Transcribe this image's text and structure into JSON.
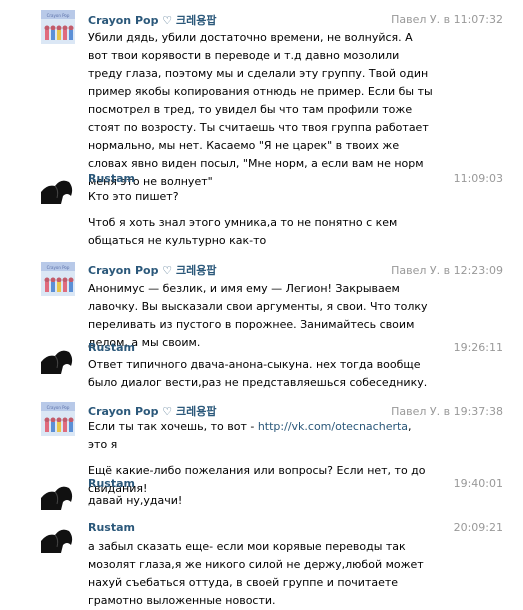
{
  "messages": [
    {
      "author": "Crayon Pop ♡ 크레용팝",
      "reply_to": "Павел У. в",
      "time": "11:07:32",
      "avatar": "group-avatar",
      "paragraphs": [
        "Убили дядь, убили достаточно времени, не волнуйся. А вот твои корявости в переводе и т.д давно мозолили треду глаза, поэтому мы и сделали эту группу. Твой один пример якобы копирования отнюдь не пример. Если бы ты посмотрел в тред, то увидел бы что там профили тоже стоят по возросту. Ты считаешь что твоя группа работает нормально, мы нет. Касаемо \"Я не царек\" в твоих же словах явно виден посыл, \"Мне норм, а если вам не норм меня это не волнует\""
      ]
    },
    {
      "author": "Rustam",
      "reply_to": "",
      "time": "11:09:03",
      "avatar": "user-avatar",
      "paragraphs": [
        "Кто это пишет?",
        "Чтоб я хоть знал этого умника,а то не понятно с кем общаться не культурно как-то"
      ]
    },
    {
      "author": "Crayon Pop ♡ 크레용팝",
      "reply_to": "Павел У. в",
      "time": "12:23:09",
      "avatar": "group-avatar",
      "paragraphs": [
        "Анонимус — безлик, и имя ему — Легион! Закрываем лавочку. Вы высказали свои аргументы, я свои. Что толку переливать из пустого в порожнее. Занимайтесь своим делом, а мы своим."
      ]
    },
    {
      "author": "Rustam",
      "reply_to": "",
      "time": "19:26:11",
      "avatar": "user-avatar",
      "paragraphs": [
        "Ответ типичного двача-анона-сыкуна. нех тогда вообще было диалог вести,раз не представляешься собеседнику."
      ]
    },
    {
      "author": "Crayon Pop ♡ 크레용팝",
      "reply_to": "Павел У. в",
      "time": "19:37:38",
      "avatar": "group-avatar",
      "link_prefix": "Если ты так хочешь, то вот - ",
      "link": "http://vk.com/otecnacherta",
      "link_suffix": ", это я",
      "paragraphs": [
        "Ещё какие-либо пожелания или вопросы? Если нет, то до свидания!"
      ]
    },
    {
      "author": "Rustam",
      "reply_to": "",
      "time": "19:40:01",
      "avatar": "user-avatar",
      "paragraphs": [
        "давай ну,удачи!"
      ]
    },
    {
      "author": "Rustam",
      "reply_to": "",
      "time": "20:09:21",
      "avatar": "user-avatar",
      "paragraphs": [
        "а забыл сказать еще- если мои корявые переводы так мозолят глаза,я же никого силой не держу,любой может нахуй съебаться оттуда, в своей группе и почитаете грамотно выложенные новости."
      ]
    }
  ],
  "colors": {
    "author": "#2b587a",
    "meta": "#999999",
    "link": "#2b587a"
  }
}
